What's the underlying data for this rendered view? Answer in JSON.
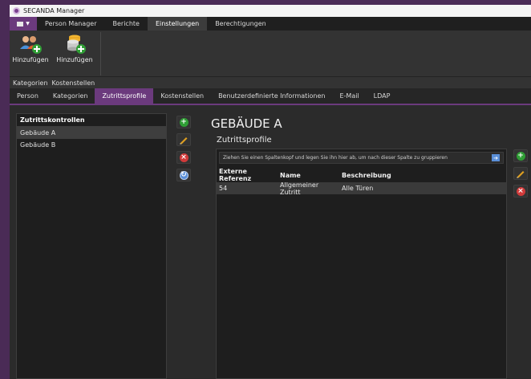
{
  "window": {
    "title": "SECANDA Manager"
  },
  "menubar": {
    "items": [
      "Person Manager",
      "Berichte",
      "Einstellungen",
      "Berechtigungen"
    ]
  },
  "ribbon": {
    "buttons": [
      {
        "label": "Hinzufügen",
        "icon": "add-person-group-icon"
      },
      {
        "label": "Hinzufügen",
        "icon": "add-cost-center-icon"
      }
    ],
    "groups": [
      "Kategorien",
      "Kostenstellen"
    ]
  },
  "tabs": [
    "Person",
    "Kategorien",
    "Zutrittsprofile",
    "Kostenstellen",
    "Benutzerdefinierte Informationen",
    "E-Mail",
    "LDAP"
  ],
  "left_panel": {
    "header": "Zutrittskontrollen",
    "items": [
      "Gebäude A",
      "Gebäude B"
    ]
  },
  "main": {
    "title": "GEBÄUDE A",
    "subtitle": "Zutrittsprofile",
    "group_hint": "Ziehen Sie einen Spaltenkopf und legen Sie ihn hier ab, um nach dieser Spalte zu gruppieren",
    "columns": [
      "Externe Referenz",
      "Name",
      "Beschreibung"
    ],
    "rows": [
      [
        "54",
        "Allgemeiner Zutritt",
        "Alle Türen"
      ]
    ]
  },
  "colors": {
    "accent": "#6b3a7d",
    "add": "#2f9e35",
    "delete": "#d13a3a",
    "edit": "#e0a020"
  }
}
